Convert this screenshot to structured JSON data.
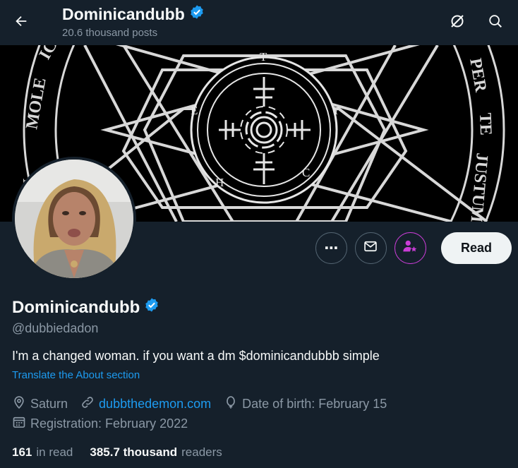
{
  "header": {
    "title": "Dominicandubb",
    "post_count": "20.6 thousand posts"
  },
  "banner": {
    "left_words": [
      "MOLE",
      "IC",
      "N"
    ],
    "right_words": [
      "PER",
      "TE",
      "JUSTUM"
    ],
    "ring_letters": [
      "T",
      "Y",
      "C",
      "H",
      "E"
    ]
  },
  "actions": {
    "more_label": "⋯",
    "read_label": "Read"
  },
  "profile": {
    "name": "Dominicandubb",
    "handle": "@dubbiedadon",
    "bio": "I'm a changed woman. if you want a dm $dominicandubbb simple",
    "translate": "Translate the About section",
    "location": "Saturn",
    "website": "dubbthedemon.com",
    "birth": "Date of birth: February 15",
    "registration": "Registration: February 2022"
  },
  "stats": {
    "in_read_count": "161",
    "in_read_label": "in read",
    "readers_count": "385.7 thousand",
    "readers_label": "readers"
  },
  "colors": {
    "background": "#15202b",
    "accent": "#1d9bf0",
    "verified": "#1d9bf0",
    "subscribe_pink": "#c93dd6",
    "muted": "#8b98a5"
  }
}
